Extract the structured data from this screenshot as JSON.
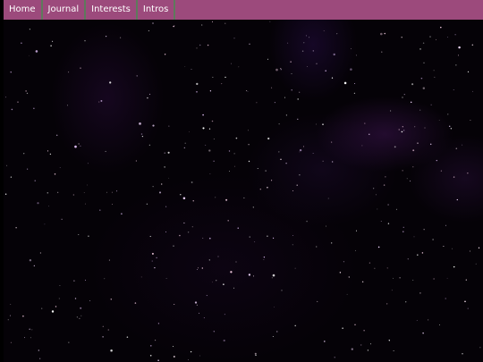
{
  "nav": {
    "items": [
      {
        "label": "Home"
      },
      {
        "label": "Journal"
      },
      {
        "label": "Interests"
      },
      {
        "label": "Intros"
      }
    ]
  },
  "colors": {
    "nav_background": "#9c4a7c",
    "nav_divider": "#5e7a5c",
    "nav_text": "#ffffff",
    "page_background": "#050207"
  }
}
